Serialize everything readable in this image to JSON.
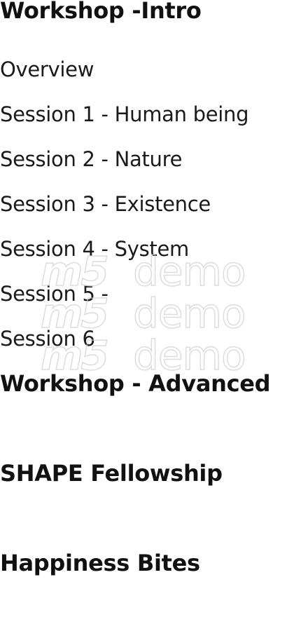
{
  "menu": {
    "intro": {
      "title": "Workshop -Intro",
      "items": [
        "Overview",
        "Session 1 - Human being",
        "Session 2 - Nature",
        "Session 3 - Existence",
        "Session 4 - System",
        "Session 5 -",
        "Session 6"
      ]
    },
    "advanced": {
      "title": "Workshop - Advanced"
    },
    "fellowship": {
      "title": "SHAPE Fellowship"
    },
    "bites": {
      "title": "Happiness Bites"
    }
  },
  "watermark": {
    "logo": "m5",
    "text": "demo"
  }
}
